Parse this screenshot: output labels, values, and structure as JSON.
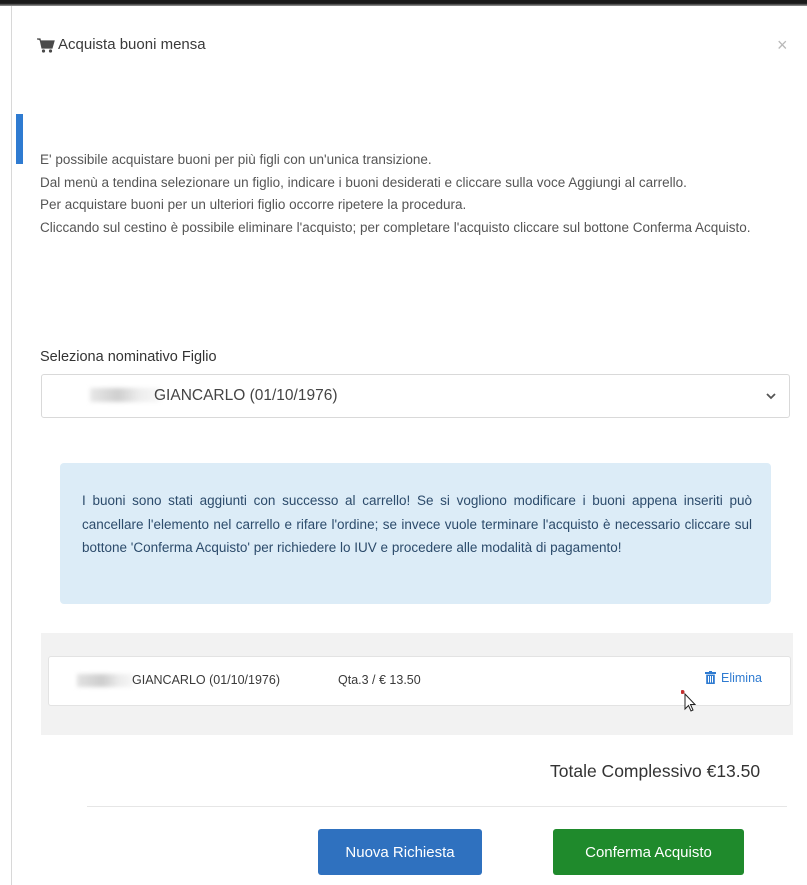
{
  "modal": {
    "title": "Acquista buoni mensa",
    "close_label": "×"
  },
  "instructions": [
    "E' possibile acquistare buoni per più figli con un'unica transizione.",
    "Dal menù a tendina selezionare un figlio, indicare i buoni desiderati e cliccare sulla voce Aggiungi al carrello.",
    "Per acquistare buoni per un ulteriori figlio occorre ripetere la procedura.",
    "Cliccando sul cestino è possibile eliminare l'acquisto; per completare l'acquisto cliccare sul bottone Conferma Acquisto."
  ],
  "child_select": {
    "label": "Seleziona nominativo Figlio",
    "selected_value": "GIANCARLO (01/10/1976)"
  },
  "alert": {
    "message": "I buoni sono stati aggiunti con successo al carrello! Se si vogliono modificare i buoni appena inseriti può cancellare l'elemento nel carrello e rifare l'ordine; se invece vuole terminare l'acquisto è necessario cliccare sul bottone 'Conferma Acquisto' per richiedere lo IUV e procedere alle modalità di pagamento!"
  },
  "cart": {
    "items": [
      {
        "name": "GIANCARLO (01/10/1976)",
        "quantity": "Qta.3 / € 13.50",
        "delete_label": "Elimina"
      }
    ]
  },
  "totals": {
    "label": "Totale Complessivo €13.50"
  },
  "actions": {
    "new_request_label": "Nuova Richiesta",
    "confirm_label": "Conferma Acquisto"
  },
  "colors": {
    "accent_blue": "#2f71bf",
    "confirm_green": "#1f8a2c",
    "alert_bg": "#dcecf7",
    "alert_text": "#2c4b6b"
  },
  "icons": {
    "header": "cart-icon",
    "close": "close-icon",
    "select": "chevron-down-icon",
    "delete": "trash-icon",
    "pointer": "cursor-icon"
  }
}
